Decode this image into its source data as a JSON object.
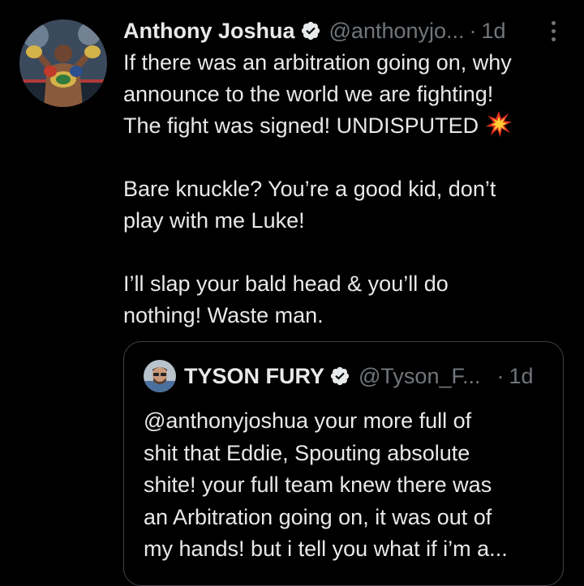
{
  "tweet": {
    "author_name": "Anthony Joshua",
    "author_handle": "@anthonyjo...",
    "separator": "·",
    "time": "1d",
    "lines": [
      "If there was an arbitration going on, why",
      "announce to the world we are fighting!",
      "The fight was signed! UNDISPUTED",
      "",
      "Bare knuckle? You’re a good kid, don’t",
      "play with me Luke!",
      "",
      "I’ll slap your bald head & you’ll do",
      "nothing! Waste man."
    ]
  },
  "quoted_tweet": {
    "author_name": "TYSON FURY",
    "author_handle": "@Tyson_F...",
    "separator": "·",
    "time": "1d",
    "lines": [
      "@anthonyjoshua your more full of",
      "shit that Eddie, Spouting absolute",
      "shite! your full team knew there was",
      "an Arbitration going on, it was out of",
      "my hands! but i tell you what if i’m a..."
    ]
  },
  "icons": {
    "verified": "verified-badge-icon",
    "more": "more-vertical-icon",
    "emoji": "collision-emoji-icon"
  },
  "colors": {
    "background": "#000000",
    "text": "#e7e9ea",
    "secondary_text": "#71767b",
    "border": "#3e4144",
    "emoji_red": "#e0301e",
    "emoji_yellow": "#ffcc33"
  }
}
